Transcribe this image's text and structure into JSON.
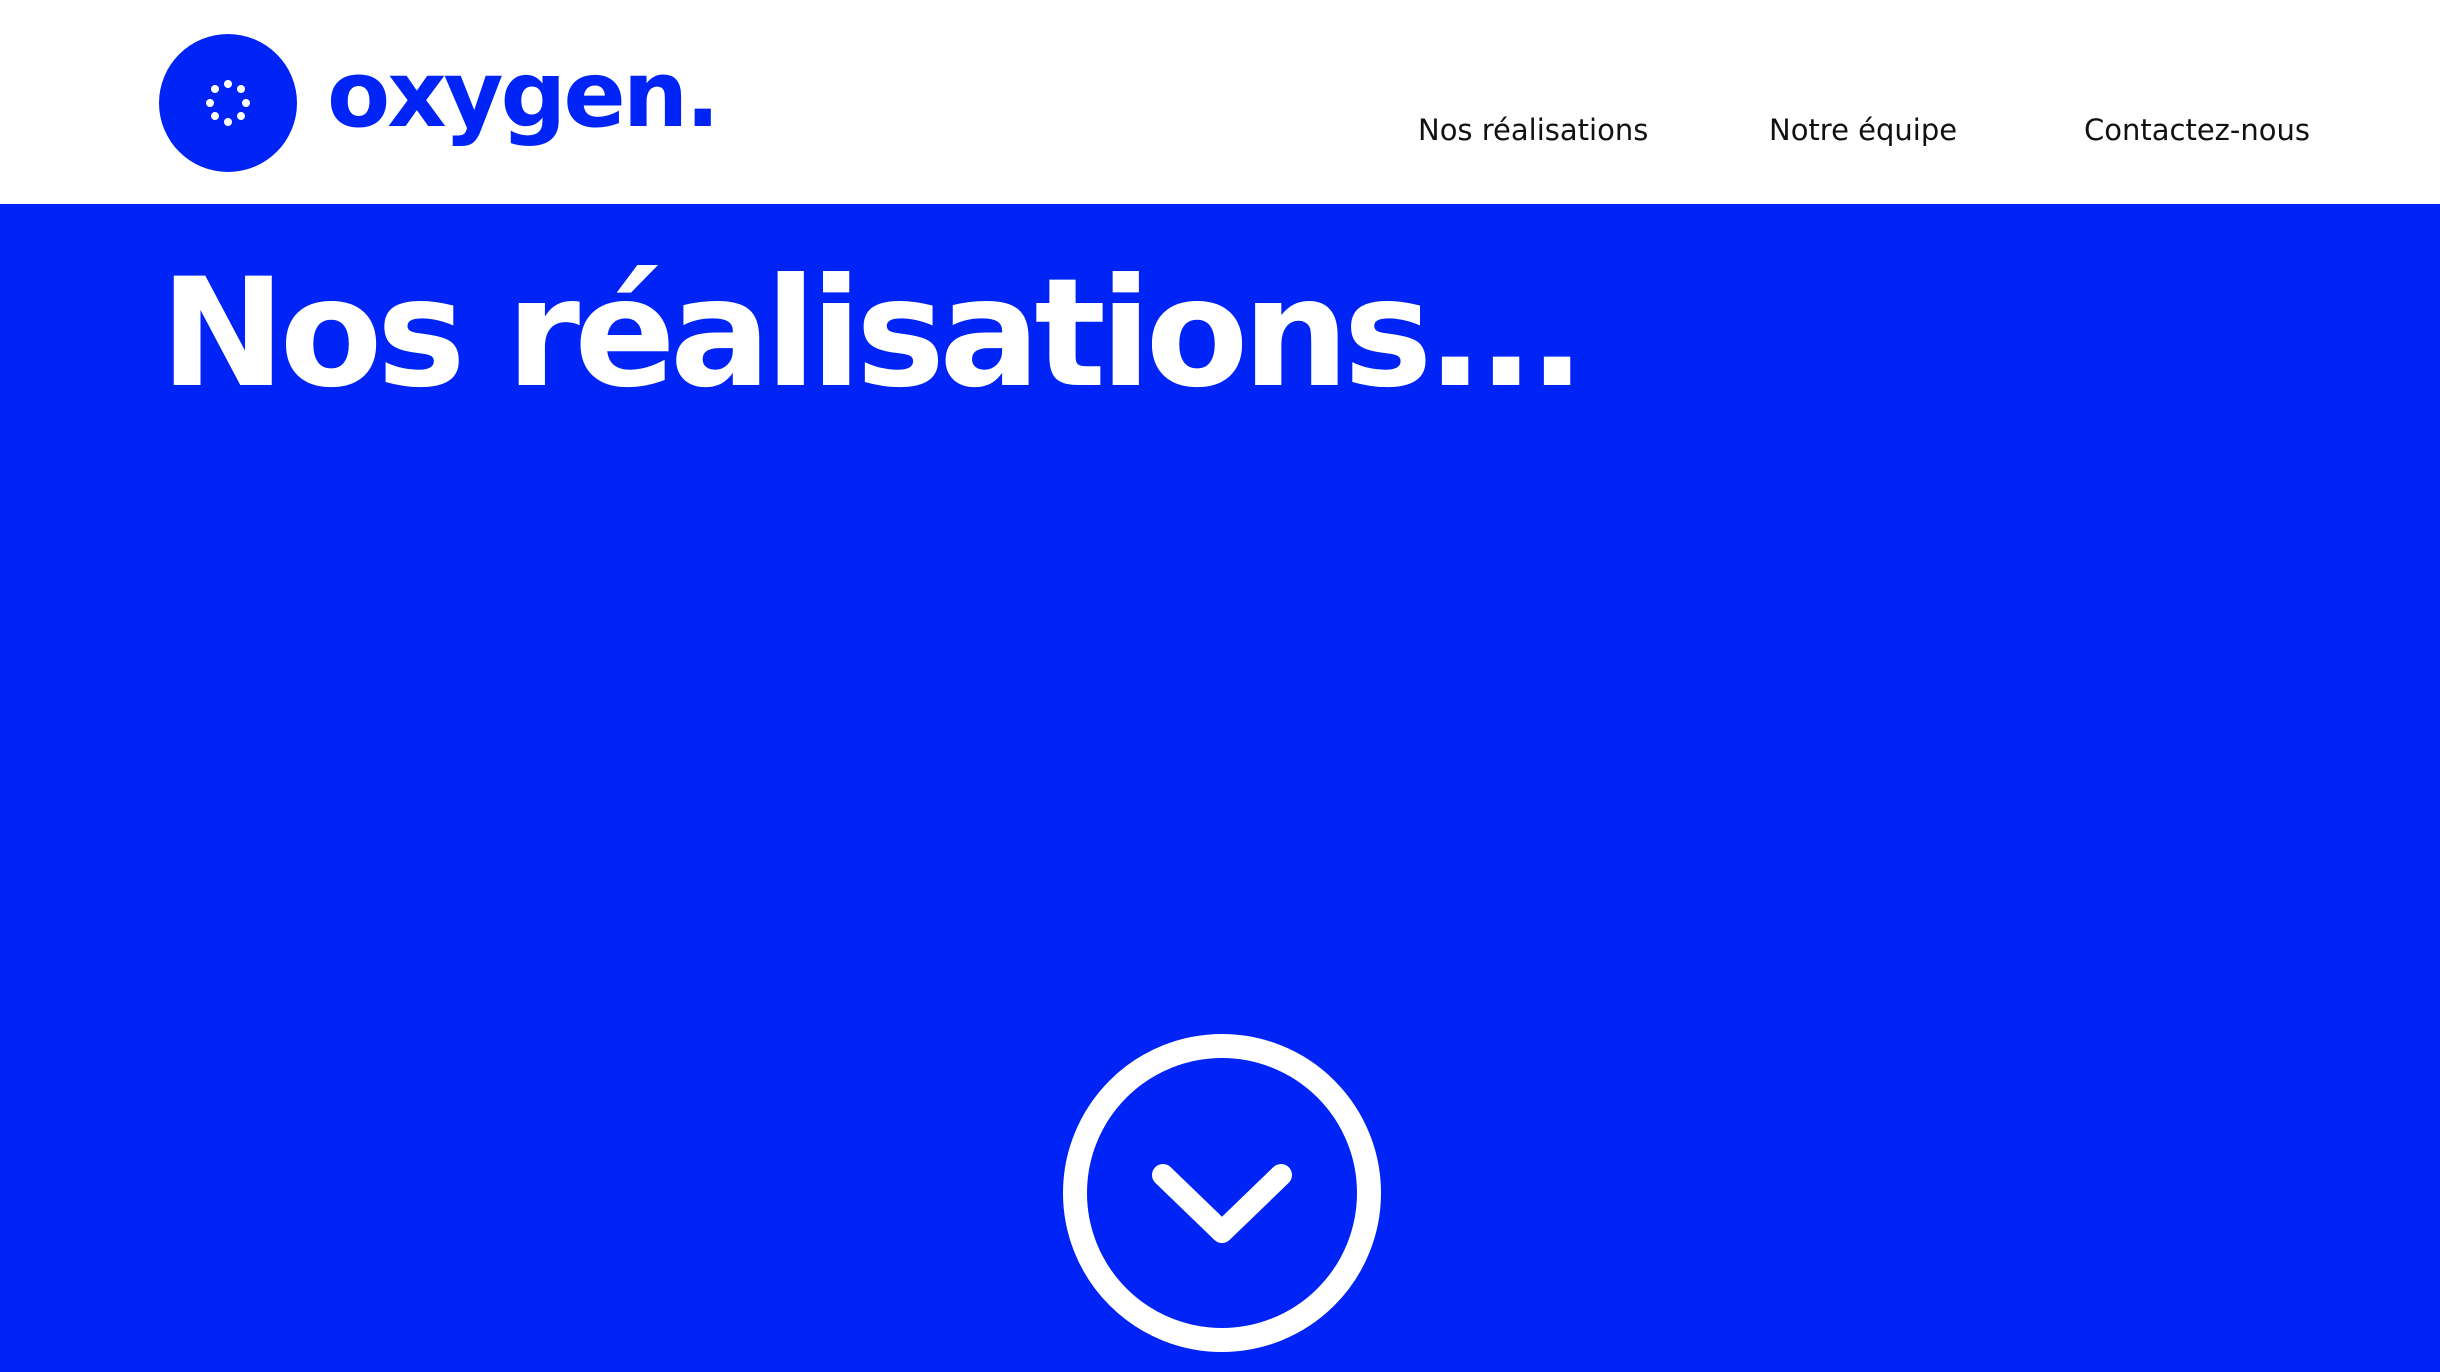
{
  "colors": {
    "brand_blue": "#0024f5",
    "header_bg": "#ffffff",
    "nav_text": "#111111",
    "hero_text": "#ffffff"
  },
  "header": {
    "logo": {
      "icon": "oxygen-logo-icon",
      "text": "oxygen."
    },
    "nav": [
      {
        "label": "Nos réalisations"
      },
      {
        "label": "Notre équipe"
      },
      {
        "label": "Contactez-nous"
      }
    ]
  },
  "hero": {
    "title": "Nos réalisations...",
    "scroll_icon": "chevron-down-circle-icon"
  }
}
